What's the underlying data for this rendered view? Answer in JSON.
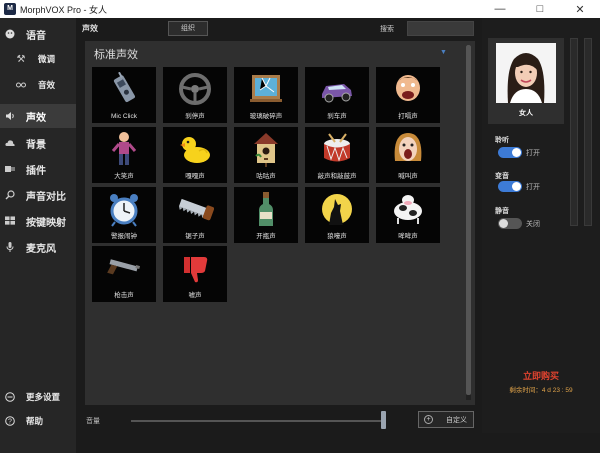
{
  "window": {
    "title": "MorphVOX Pro - 女人",
    "app_icon": "M"
  },
  "sidebar": {
    "items": [
      {
        "label": "语音",
        "icon": "face-icon"
      },
      {
        "label": "微调",
        "icon": "tools-icon"
      },
      {
        "label": "音效",
        "icon": "glasses-icon"
      },
      {
        "label": "声效",
        "icon": "speaker-icon"
      },
      {
        "label": "背景",
        "icon": "cloud-icon"
      },
      {
        "label": "插件",
        "icon": "plugin-icon"
      },
      {
        "label": "声音对比",
        "icon": "magnifier-icon"
      },
      {
        "label": "按键映射",
        "icon": "keyboard-icon"
      },
      {
        "label": "麦克风",
        "icon": "microphone-icon"
      }
    ],
    "more_settings": "更多设置",
    "help": "帮助"
  },
  "header": {
    "section": "声效",
    "group_button": "组织",
    "search_label": "搜索",
    "search_value": ""
  },
  "panel": {
    "title": "标准声效",
    "effects": [
      {
        "name": "Mic Click",
        "icon": "walkie-talkie-icon"
      },
      {
        "name": "刹停声",
        "icon": "steering-wheel-icon"
      },
      {
        "name": "玻璃破碎声",
        "icon": "broken-window-icon"
      },
      {
        "name": "刹车声",
        "icon": "car-icon"
      },
      {
        "name": "打嗝声",
        "icon": "burping-face-icon"
      },
      {
        "name": "大笑声",
        "icon": "laughing-man-icon"
      },
      {
        "name": "嘎嘎声",
        "icon": "duck-icon"
      },
      {
        "name": "咕咕声",
        "icon": "birdhouse-icon"
      },
      {
        "name": "敲声和敲鼓声",
        "icon": "drum-icon"
      },
      {
        "name": "喊叫声",
        "icon": "screaming-face-icon"
      },
      {
        "name": "警报闹钟",
        "icon": "alarm-clock-icon"
      },
      {
        "name": "锯子声",
        "icon": "saw-icon"
      },
      {
        "name": "开瓶声",
        "icon": "bottle-icon"
      },
      {
        "name": "狼嚎声",
        "icon": "howling-wolf-icon"
      },
      {
        "name": "哞哞声",
        "icon": "cow-icon"
      },
      {
        "name": "枪击声",
        "icon": "gun-icon"
      },
      {
        "name": "嘘声",
        "icon": "thumbs-down-icon"
      }
    ]
  },
  "bottom": {
    "volume_label": "音量",
    "volume_level": 0.98,
    "custom_button": "自定义"
  },
  "right": {
    "voice_name": "女人",
    "listen": {
      "label": "聆听",
      "state": "打开",
      "on": true
    },
    "morph": {
      "label": "变音",
      "state": "打开",
      "on": true
    },
    "mute": {
      "label": "静音",
      "state": "关闭",
      "on": false
    },
    "buy_label": "立即购买",
    "remaining_label": "剩余时间：",
    "remaining_value": "4 d 23 : 59"
  },
  "colors": {
    "accent": "#3d7bd6",
    "buy": "#e0432f",
    "remaining": "#e0a34a"
  }
}
